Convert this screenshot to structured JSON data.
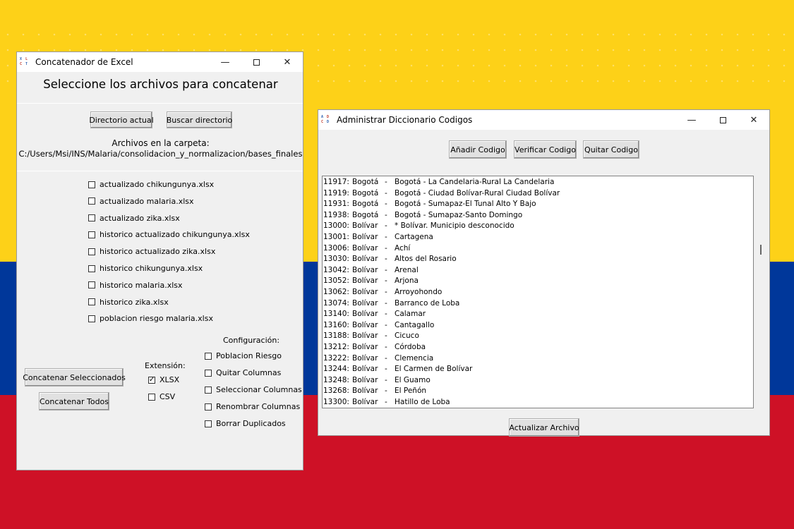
{
  "concat_window": {
    "title": "Concatenador de Excel",
    "heading": "Seleccione los archivos para concatenar",
    "btn_directorio_actual": "Directorio actual",
    "btn_buscar_directorio": "Buscar directorio",
    "folder_label": "Archivos en la carpeta:",
    "folder_path": "C:/Users/Msi/INS/Malaria/consolidacion_y_normalizacion/bases_finales",
    "files": [
      {
        "name": "actualizado chikungunya.xlsx",
        "checked": false
      },
      {
        "name": "actualizado malaria.xlsx",
        "checked": false
      },
      {
        "name": "actualizado zika.xlsx",
        "checked": false
      },
      {
        "name": "historico actualizado chikungunya.xlsx",
        "checked": false
      },
      {
        "name": "historico actualizado zika.xlsx",
        "checked": false
      },
      {
        "name": "historico chikungunya.xlsx",
        "checked": false
      },
      {
        "name": "historico malaria.xlsx",
        "checked": false
      },
      {
        "name": "historico zika.xlsx",
        "checked": false
      },
      {
        "name": "poblacion riesgo malaria.xlsx",
        "checked": false
      }
    ],
    "btn_concatenar_seleccionados": "Concatenar Seleccionados",
    "btn_concatenar_todos": "Concatenar Todos",
    "extension_label": "Extensión:",
    "extensions": [
      {
        "name": "XLSX",
        "checked": true
      },
      {
        "name": "CSV",
        "checked": false
      }
    ],
    "config_label": "Configuración:",
    "config_options": [
      {
        "name": "Poblacion Riesgo",
        "checked": false
      },
      {
        "name": "Quitar Columnas",
        "checked": false
      },
      {
        "name": "Seleccionar Columnas",
        "checked": false
      },
      {
        "name": "Renombrar Columnas",
        "checked": false
      },
      {
        "name": "Borrar Duplicados",
        "checked": false
      }
    ]
  },
  "dict_window": {
    "title": "Administrar Diccionario Codigos",
    "btn_anadir": "Añadir Codigo",
    "btn_verificar": "Verificar Codigo",
    "btn_quitar": "Quitar Codigo",
    "btn_actualizar": "Actualizar Archivo",
    "rows": [
      {
        "code": "11917:",
        "dep": "Bogotá",
        "dash": "-",
        "mun": "Bogotá - La Candelaria-Rural La Candelaria"
      },
      {
        "code": "11919:",
        "dep": "Bogotá",
        "dash": "-",
        "mun": "Bogotá - Ciudad Bolívar-Rural Ciudad Bolívar"
      },
      {
        "code": "11931:",
        "dep": "Bogotá",
        "dash": "-",
        "mun": "Bogotá - Sumapaz-El Tunal Alto Y Bajo"
      },
      {
        "code": "11938:",
        "dep": "Bogotá",
        "dash": "-",
        "mun": "Bogotá - Sumapaz-Santo Domingo"
      },
      {
        "code": "13000:",
        "dep": "Bolívar",
        "dash": "-",
        "mun": "* Bolívar. Municipio desconocido"
      },
      {
        "code": "13001:",
        "dep": "Bolívar",
        "dash": "-",
        "mun": "Cartagena"
      },
      {
        "code": "13006:",
        "dep": "Bolívar",
        "dash": "-",
        "mun": "Achí"
      },
      {
        "code": "13030:",
        "dep": "Bolívar",
        "dash": "-",
        "mun": "Altos del Rosario"
      },
      {
        "code": "13042:",
        "dep": "Bolívar",
        "dash": "-",
        "mun": "Arenal"
      },
      {
        "code": "13052:",
        "dep": "Bolívar",
        "dash": "-",
        "mun": "Arjona"
      },
      {
        "code": "13062:",
        "dep": "Bolívar",
        "dash": "-",
        "mun": "Arroyohondo"
      },
      {
        "code": "13074:",
        "dep": "Bolívar",
        "dash": "-",
        "mun": "Barranco de Loba"
      },
      {
        "code": "13140:",
        "dep": "Bolívar",
        "dash": "-",
        "mun": "Calamar"
      },
      {
        "code": "13160:",
        "dep": "Bolívar",
        "dash": "-",
        "mun": "Cantagallo"
      },
      {
        "code": "13188:",
        "dep": "Bolívar",
        "dash": "-",
        "mun": "Cicuco"
      },
      {
        "code": "13212:",
        "dep": "Bolívar",
        "dash": "-",
        "mun": "Córdoba"
      },
      {
        "code": "13222:",
        "dep": "Bolívar",
        "dash": "-",
        "mun": "Clemencia"
      },
      {
        "code": "13244:",
        "dep": "Bolívar",
        "dash": "-",
        "mun": "El Carmen de Bolívar"
      },
      {
        "code": "13248:",
        "dep": "Bolívar",
        "dash": "-",
        "mun": "El Guamo"
      },
      {
        "code": "13268:",
        "dep": "Bolívar",
        "dash": "-",
        "mun": "El Peñón"
      },
      {
        "code": "13300:",
        "dep": "Bolívar",
        "dash": "-",
        "mun": "Hatillo de Loba"
      }
    ]
  },
  "window_controls": {
    "minimize": "—",
    "close": "✕"
  },
  "colors": {
    "flag_yellow": "#fdd118",
    "flag_blue": "#00379a",
    "flag_red": "#ce1126"
  }
}
